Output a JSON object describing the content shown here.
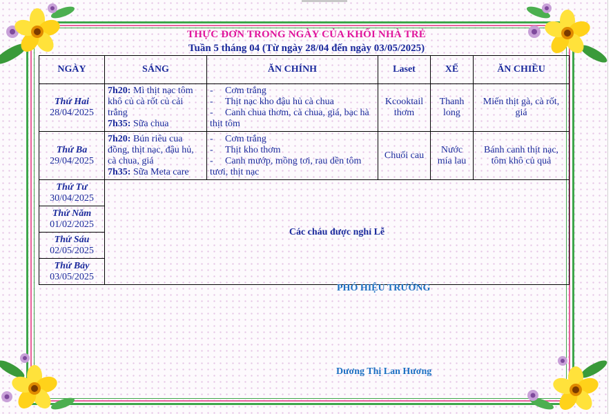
{
  "header": {
    "title": "THỰC ĐƠN TRONG NGÀY CỦA KHỐI NHÀ TRẺ",
    "subtitle": "Tuần 5 tháng 04 (Từ ngày 28/04 đến ngày 03/05/2025)"
  },
  "columns": [
    "NGÀY",
    "SÁNG",
    "ĂN CHÍNH",
    "Laset",
    "XẾ",
    "ĂN CHIỀU"
  ],
  "days": [
    {
      "name": "Thứ Hai",
      "date": "28/04/2025",
      "morning": [
        {
          "time": "7h20:",
          "text": " Mì thịt nạc tôm khô củ cà rốt củ cải trắng"
        },
        {
          "time": "7h35:",
          "text": " Sữa chua"
        }
      ],
      "main": [
        "Cơm trắng",
        "Thịt nạc kho đậu hủ cà chua",
        "Canh chua thơm, cà chua, giá, bạc hà thịt tôm"
      ],
      "laset": "Kcooktail thơm",
      "snack": "Thanh long",
      "afternoon": "Miến thịt gà, cà rốt, giá"
    },
    {
      "name": "Thứ Ba",
      "date": "29/04/2025",
      "morning": [
        {
          "time": "7h20:",
          "text": " Bún riêu cua đồng, thịt nạc, đậu hủ, cà chua, giá"
        },
        {
          "time": "7h35:",
          "text": " Sữa Meta care"
        }
      ],
      "main": [
        "Cơm trắng",
        "Thịt kho thơm",
        "Canh mướp, mồng tơi, rau dền tôm tươi, thịt nạc"
      ],
      "laset": "Chuối cau",
      "snack": "Nước mía lau",
      "afternoon": "Bánh canh thịt nạc, tôm khô củ quả"
    }
  ],
  "holiday_days": [
    {
      "name": "Thứ Tư",
      "date": "30/04/2025"
    },
    {
      "name": "Thứ Năm",
      "date": "01/02/2025"
    },
    {
      "name": "Thứ Sáu",
      "date": "02/05/2025"
    },
    {
      "name": "Thứ Bảy",
      "date": "03/05/2025"
    }
  ],
  "holiday_text": "Các cháu được nghỉ Lễ",
  "signature": {
    "position": "PHÓ HIỆU TRƯỞNG",
    "name": "Dương Thị Lan Hương"
  },
  "colors": {
    "title": "#e0149b",
    "text": "#1a2a9c",
    "signature": "#1b6fc2",
    "frame_green": "#3da64a",
    "frame_pink": "#e8609a"
  },
  "icons": [
    "flower-icon"
  ]
}
